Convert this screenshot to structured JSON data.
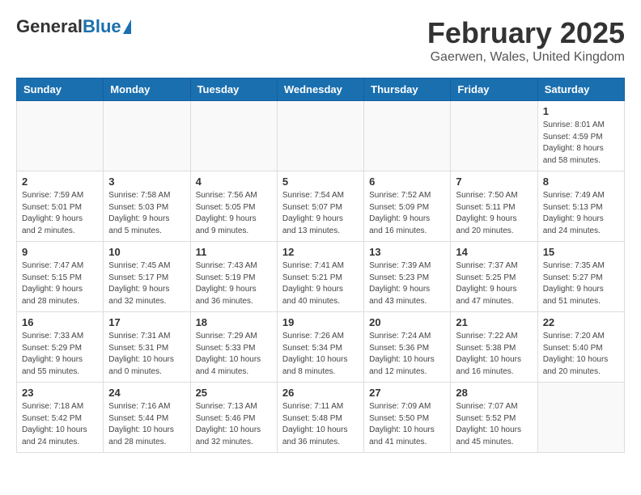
{
  "logo": {
    "general": "General",
    "blue": "Blue"
  },
  "title": "February 2025",
  "location": "Gaerwen, Wales, United Kingdom",
  "weekdays": [
    "Sunday",
    "Monday",
    "Tuesday",
    "Wednesday",
    "Thursday",
    "Friday",
    "Saturday"
  ],
  "weeks": [
    [
      {
        "day": "",
        "info": ""
      },
      {
        "day": "",
        "info": ""
      },
      {
        "day": "",
        "info": ""
      },
      {
        "day": "",
        "info": ""
      },
      {
        "day": "",
        "info": ""
      },
      {
        "day": "",
        "info": ""
      },
      {
        "day": "1",
        "info": "Sunrise: 8:01 AM\nSunset: 4:59 PM\nDaylight: 8 hours and 58 minutes."
      }
    ],
    [
      {
        "day": "2",
        "info": "Sunrise: 7:59 AM\nSunset: 5:01 PM\nDaylight: 9 hours and 2 minutes."
      },
      {
        "day": "3",
        "info": "Sunrise: 7:58 AM\nSunset: 5:03 PM\nDaylight: 9 hours and 5 minutes."
      },
      {
        "day": "4",
        "info": "Sunrise: 7:56 AM\nSunset: 5:05 PM\nDaylight: 9 hours and 9 minutes."
      },
      {
        "day": "5",
        "info": "Sunrise: 7:54 AM\nSunset: 5:07 PM\nDaylight: 9 hours and 13 minutes."
      },
      {
        "day": "6",
        "info": "Sunrise: 7:52 AM\nSunset: 5:09 PM\nDaylight: 9 hours and 16 minutes."
      },
      {
        "day": "7",
        "info": "Sunrise: 7:50 AM\nSunset: 5:11 PM\nDaylight: 9 hours and 20 minutes."
      },
      {
        "day": "8",
        "info": "Sunrise: 7:49 AM\nSunset: 5:13 PM\nDaylight: 9 hours and 24 minutes."
      }
    ],
    [
      {
        "day": "9",
        "info": "Sunrise: 7:47 AM\nSunset: 5:15 PM\nDaylight: 9 hours and 28 minutes."
      },
      {
        "day": "10",
        "info": "Sunrise: 7:45 AM\nSunset: 5:17 PM\nDaylight: 9 hours and 32 minutes."
      },
      {
        "day": "11",
        "info": "Sunrise: 7:43 AM\nSunset: 5:19 PM\nDaylight: 9 hours and 36 minutes."
      },
      {
        "day": "12",
        "info": "Sunrise: 7:41 AM\nSunset: 5:21 PM\nDaylight: 9 hours and 40 minutes."
      },
      {
        "day": "13",
        "info": "Sunrise: 7:39 AM\nSunset: 5:23 PM\nDaylight: 9 hours and 43 minutes."
      },
      {
        "day": "14",
        "info": "Sunrise: 7:37 AM\nSunset: 5:25 PM\nDaylight: 9 hours and 47 minutes."
      },
      {
        "day": "15",
        "info": "Sunrise: 7:35 AM\nSunset: 5:27 PM\nDaylight: 9 hours and 51 minutes."
      }
    ],
    [
      {
        "day": "16",
        "info": "Sunrise: 7:33 AM\nSunset: 5:29 PM\nDaylight: 9 hours and 55 minutes."
      },
      {
        "day": "17",
        "info": "Sunrise: 7:31 AM\nSunset: 5:31 PM\nDaylight: 10 hours and 0 minutes."
      },
      {
        "day": "18",
        "info": "Sunrise: 7:29 AM\nSunset: 5:33 PM\nDaylight: 10 hours and 4 minutes."
      },
      {
        "day": "19",
        "info": "Sunrise: 7:26 AM\nSunset: 5:34 PM\nDaylight: 10 hours and 8 minutes."
      },
      {
        "day": "20",
        "info": "Sunrise: 7:24 AM\nSunset: 5:36 PM\nDaylight: 10 hours and 12 minutes."
      },
      {
        "day": "21",
        "info": "Sunrise: 7:22 AM\nSunset: 5:38 PM\nDaylight: 10 hours and 16 minutes."
      },
      {
        "day": "22",
        "info": "Sunrise: 7:20 AM\nSunset: 5:40 PM\nDaylight: 10 hours and 20 minutes."
      }
    ],
    [
      {
        "day": "23",
        "info": "Sunrise: 7:18 AM\nSunset: 5:42 PM\nDaylight: 10 hours and 24 minutes."
      },
      {
        "day": "24",
        "info": "Sunrise: 7:16 AM\nSunset: 5:44 PM\nDaylight: 10 hours and 28 minutes."
      },
      {
        "day": "25",
        "info": "Sunrise: 7:13 AM\nSunset: 5:46 PM\nDaylight: 10 hours and 32 minutes."
      },
      {
        "day": "26",
        "info": "Sunrise: 7:11 AM\nSunset: 5:48 PM\nDaylight: 10 hours and 36 minutes."
      },
      {
        "day": "27",
        "info": "Sunrise: 7:09 AM\nSunset: 5:50 PM\nDaylight: 10 hours and 41 minutes."
      },
      {
        "day": "28",
        "info": "Sunrise: 7:07 AM\nSunset: 5:52 PM\nDaylight: 10 hours and 45 minutes."
      },
      {
        "day": "",
        "info": ""
      }
    ]
  ]
}
